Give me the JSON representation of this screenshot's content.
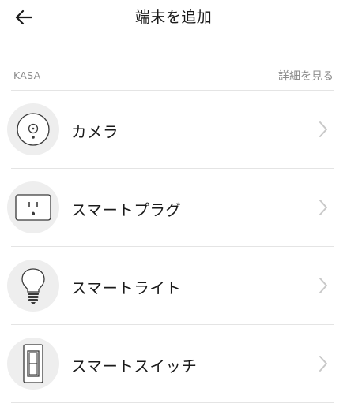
{
  "header": {
    "title": "端末を追加"
  },
  "section": {
    "label": "KASA",
    "details_link": "詳細を見る"
  },
  "items": [
    {
      "label": "カメラ",
      "icon": "camera-icon"
    },
    {
      "label": "スマートプラグ",
      "icon": "smart-plug-icon"
    },
    {
      "label": "スマートライト",
      "icon": "light-bulb-icon"
    },
    {
      "label": "スマートスイッチ",
      "icon": "light-switch-icon"
    }
  ],
  "colors": {
    "text": "#1a1a1a",
    "muted": "#8c8c8c",
    "divider": "#e4e4e4",
    "icon_bg": "#eeeeee",
    "chevron": "#c8c8c8"
  }
}
